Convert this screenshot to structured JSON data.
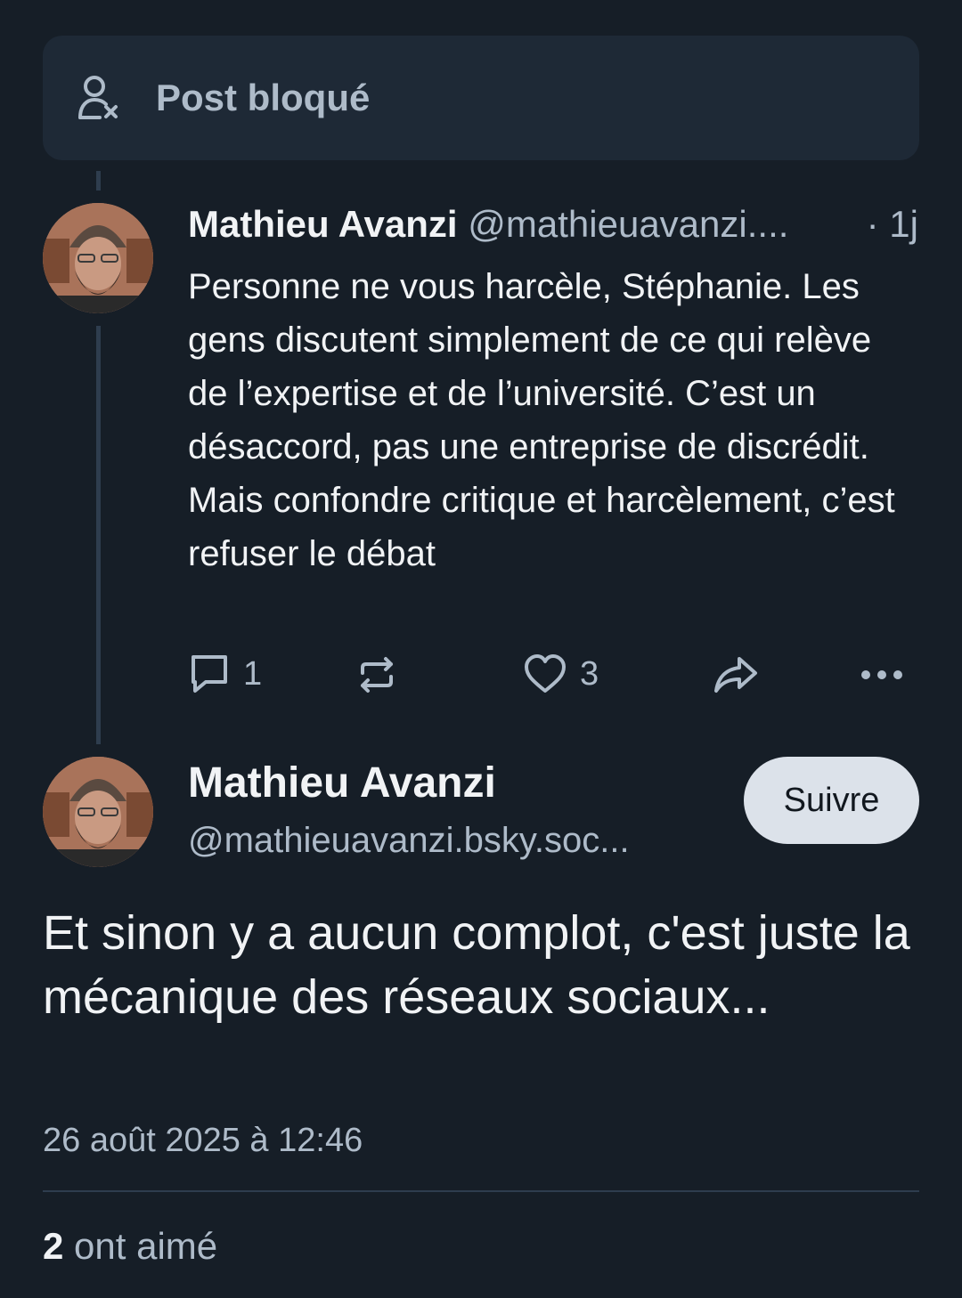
{
  "blocked_post": {
    "label": "Post bloqué",
    "icon": "person-x-icon"
  },
  "reply_post": {
    "author_name": "Mathieu Avanzi",
    "author_handle": "@mathieuavanzi....",
    "time": "· 1j",
    "text": "Personne ne vous harcèle, Stéphanie. Les gens discutent simplement de ce qui relève de l’expertise et de l’université. C’est un désaccord, pas une entreprise de discrédit. Mais confondre critique et harcèlement, c’est refuser le débat",
    "actions": {
      "reply_count": "1",
      "like_count": "3",
      "icons": [
        "comment-icon",
        "repost-icon",
        "heart-icon",
        "share-icon",
        "more-icon"
      ]
    }
  },
  "main_post": {
    "author_name": "Mathieu Avanzi",
    "author_handle": "@mathieuavanzi.bsky.soc...",
    "follow_label": "Suivre",
    "text": "Et sinon y a aucun complot, c'est juste la mécanique des réseaux sociaux...",
    "timestamp": "26 août 2025 à 12:46",
    "likes_count": "2",
    "likes_label": "ont aimé"
  },
  "colors": {
    "background": "#161e27",
    "card": "#1e2936",
    "muted_text": "#aebbc9",
    "thread_line": "#2e3d4e",
    "follow_button": "#dce2ea"
  }
}
